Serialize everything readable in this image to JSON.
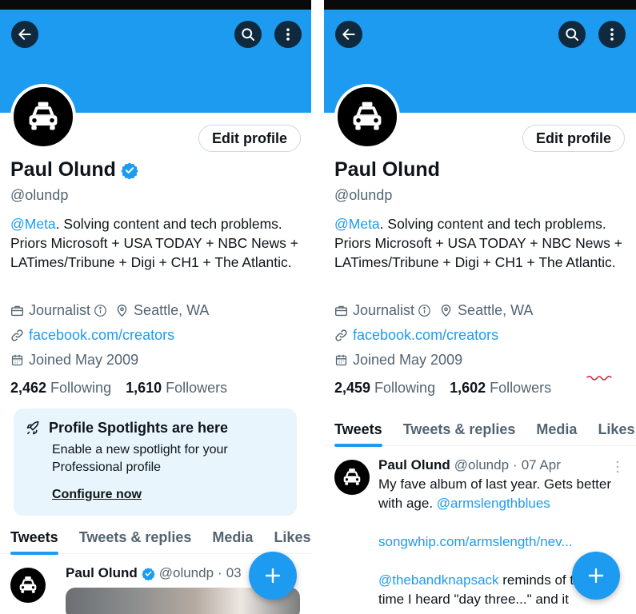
{
  "left": {
    "name": "Paul Olund",
    "handle": "@olundp",
    "edit_profile": "Edit profile",
    "bio": {
      "mention": "@Meta",
      "text": ". Solving content and tech problems. Priors Microsoft + USA TODAY + NBC News + LATimes/Tribune + Digi + CH1 + The Atlantic."
    },
    "profession": "Journalist",
    "location": "Seattle, WA",
    "website": "facebook.com/creators",
    "joined": "Joined May 2009",
    "following_count": "2,462",
    "following_label": "Following",
    "followers_count": "1,610",
    "followers_label": "Followers",
    "spotlight": {
      "title": "Profile Spotlights are here",
      "description": "Enable a new spotlight for your Professional profile",
      "cta": "Configure now"
    },
    "tabs": [
      "Tweets",
      "Tweets & replies",
      "Media",
      "Likes"
    ],
    "tweet": {
      "name": "Paul Olund",
      "handle": "@olundp",
      "separator": "·",
      "date": "03"
    }
  },
  "right": {
    "name": "Paul Olund",
    "handle": "@olundp",
    "edit_profile": "Edit profile",
    "bio": {
      "mention": "@Meta",
      "text": ". Solving content and tech problems. Priors Microsoft + USA TODAY + NBC News + LATimes/Tribune + Digi + CH1 + The Atlantic."
    },
    "profession": "Journalist",
    "location": "Seattle, WA",
    "website": "facebook.com/creators",
    "joined": "Joined May 2009",
    "following_count": "2,459",
    "following_label": "Following",
    "followers_count": "1,602",
    "followers_label": "Followers",
    "tabs": [
      "Tweets",
      "Tweets & replies",
      "Media",
      "Likes"
    ],
    "tweet": {
      "name": "Paul Olund",
      "handle": "@olundp",
      "separator": "·",
      "date": "07 Apr",
      "text_line": "My fave album of last year. Gets better with age.",
      "mention": "@armslengthblues",
      "link": "songwhip.com/armslength/nev...",
      "mention2": "@thebandknapsack",
      "text2": "reminds of the first time I heard \"day three...\" and it"
    }
  },
  "colors": {
    "accent": "#1d9bf0",
    "banner": "#1d9bf0",
    "text_primary": "#0f1419",
    "text_secondary": "#536471",
    "spotlight_bg": "#e8f5fd"
  },
  "icons": [
    "back-arrow-icon",
    "search-icon",
    "more-vertical-icon",
    "verified-badge-icon",
    "briefcase-icon",
    "info-icon",
    "location-pin-icon",
    "link-icon",
    "calendar-icon",
    "rocket-icon",
    "plus-icon",
    "taxi-icon"
  ]
}
